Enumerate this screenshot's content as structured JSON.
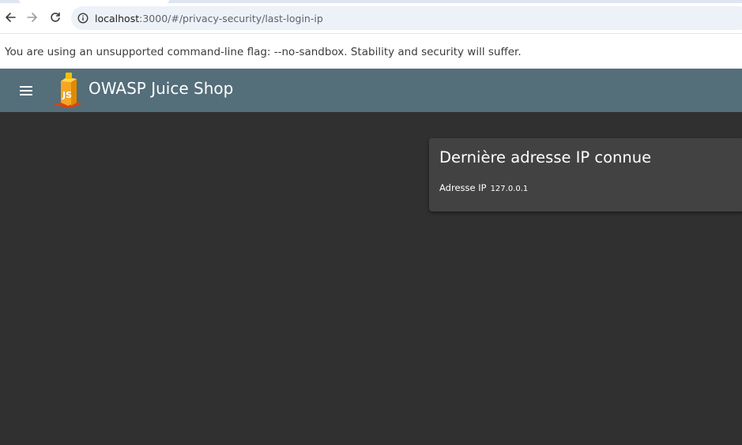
{
  "browser": {
    "url_host": "localhost",
    "url_path": ":3000/#/privacy-security/last-login-ip",
    "back_icon": "arrow-left-icon",
    "forward_icon": "arrow-right-icon",
    "reload_icon": "reload-icon",
    "site_info_icon": "info-icon"
  },
  "infobar": {
    "message": "You are using an unsupported command-line flag: --no-sandbox. Stability and security will suffer."
  },
  "header": {
    "title": "OWASP Juice Shop",
    "menu_icon": "hamburger-menu-icon",
    "logo_icon": "juice-shop-logo-icon",
    "color": "#546e7a"
  },
  "card": {
    "title": "Dernière adresse IP connue",
    "ip_label": "Adresse IP",
    "ip_value": "127.0.0.1"
  },
  "colors": {
    "background": "#303030",
    "card": "#424242",
    "header": "#546e7a"
  }
}
